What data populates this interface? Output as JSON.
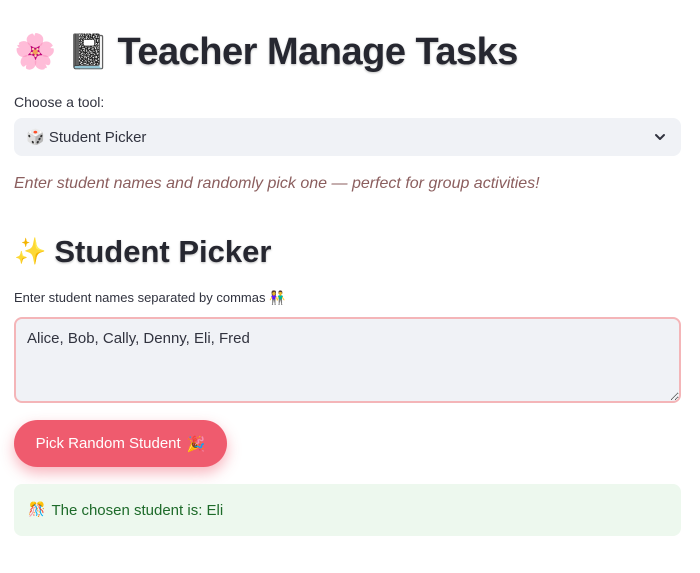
{
  "header": {
    "emojis": "🌸 📓",
    "title": "Teacher Manage Tasks"
  },
  "tool_select": {
    "label": "Choose a tool:",
    "selected_icon": "🎲",
    "selected": "Student Picker"
  },
  "tagline": "Enter student names and randomly pick one — perfect for group activities!",
  "section": {
    "emoji": "✨",
    "title": "Student Picker"
  },
  "names_input": {
    "label": "Enter student names separated by commas 👫",
    "value": "Alice, Bob, Cally, Denny, Eli, Fred"
  },
  "pick_button": {
    "label": "Pick Random Student",
    "emoji": "🎉"
  },
  "result": {
    "icon": "🎊",
    "text": "The chosen student is: Eli"
  },
  "colors": {
    "button": "#ef5b6e",
    "result_bg": "#edf8ee",
    "result_text": "#1e6b2a",
    "tagline": "#8b5e5e"
  }
}
